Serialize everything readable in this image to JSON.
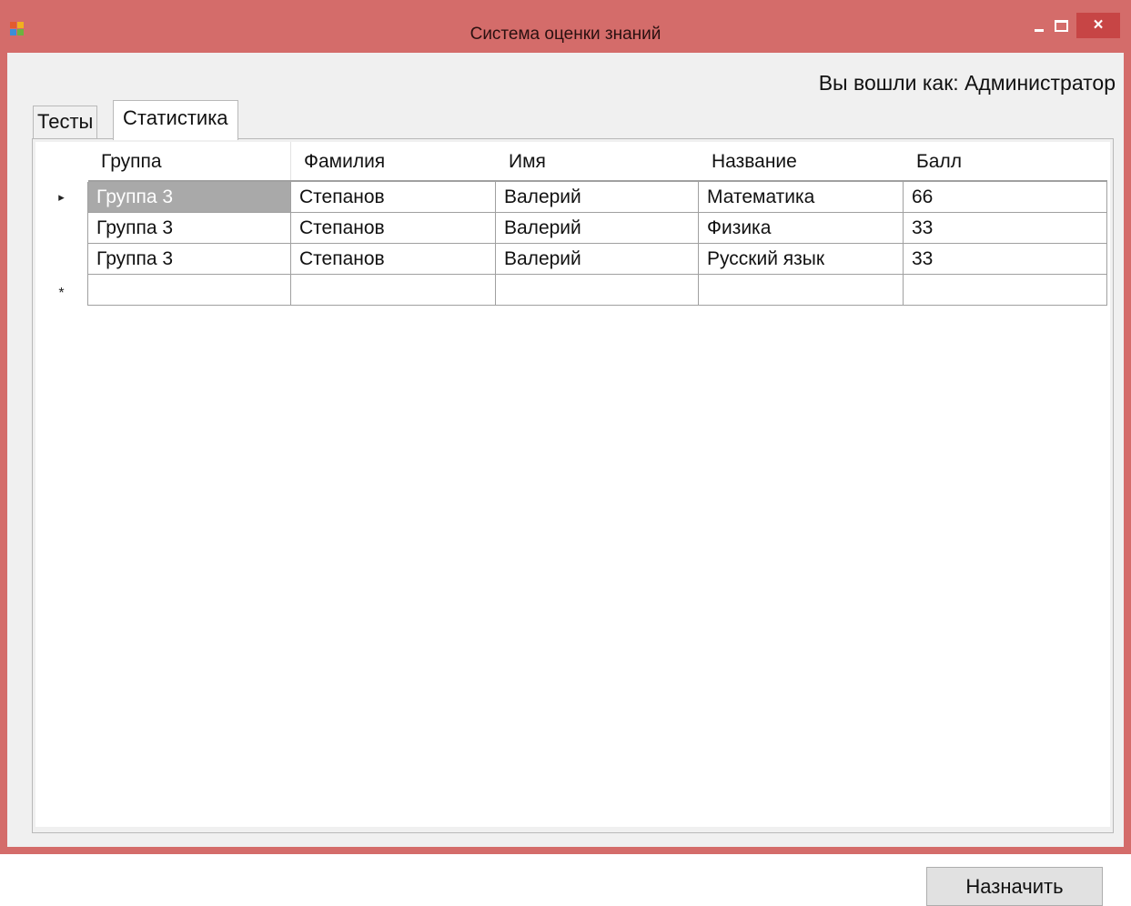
{
  "window": {
    "title": "Система оценки знаний",
    "close_glyph": "×"
  },
  "login_label": "Вы вошли как: Администратор",
  "tabs": [
    {
      "label": "Тесты",
      "active": false
    },
    {
      "label": "Статистика",
      "active": true
    }
  ],
  "grid": {
    "columns": [
      "Группа",
      "Фамилия",
      "Имя",
      "Название",
      "Балл"
    ],
    "rows": [
      {
        "indicator": "▸",
        "cells": [
          "Группа 3",
          "Степанов",
          "Валерий",
          "Математика",
          "66"
        ]
      },
      {
        "indicator": "",
        "cells": [
          "Группа 3",
          "Степанов",
          "Валерий",
          "Физика",
          "33"
        ]
      },
      {
        "indicator": "",
        "cells": [
          "Группа 3",
          "Степанов",
          "Валерий",
          "Русский язык",
          "33"
        ]
      }
    ],
    "new_row_indicator": "*"
  },
  "assign_button": "Назначить",
  "colors": {
    "titlebar": "#d46c6a",
    "close_button": "#c74545",
    "selected_cell": "#a9a9a9"
  }
}
